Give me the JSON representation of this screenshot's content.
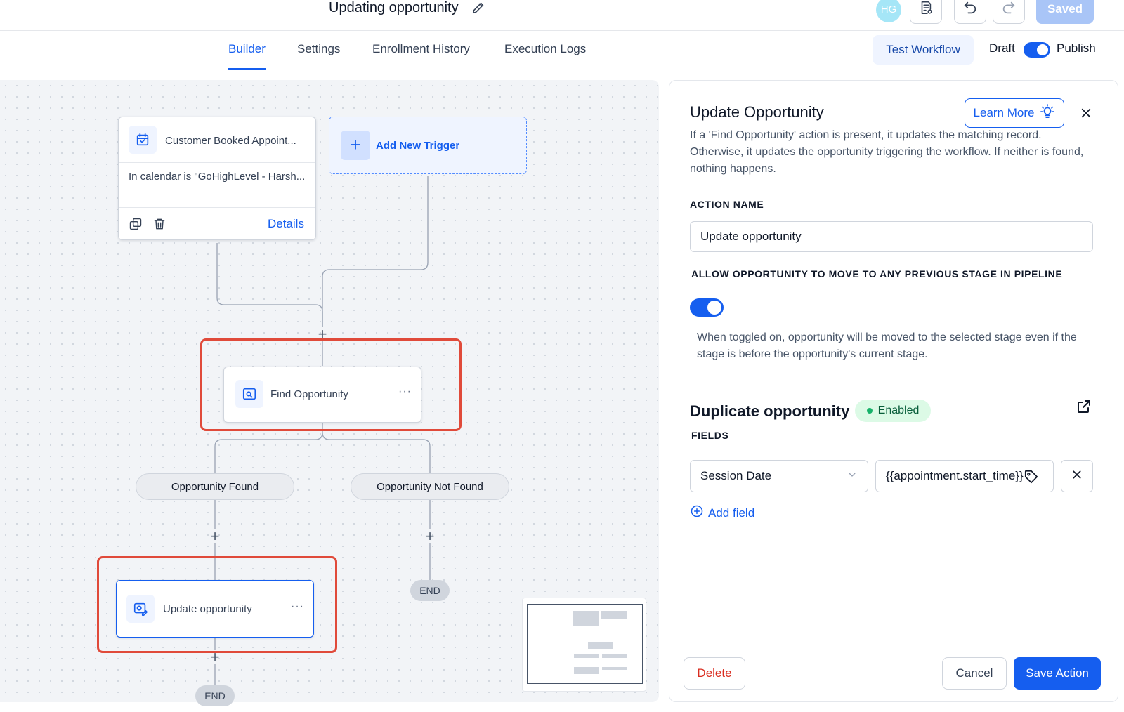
{
  "header": {
    "title": "Updating opportunity",
    "avatar_initials": "HG",
    "saved_label": "Saved"
  },
  "tabs": [
    {
      "label": "Builder",
      "active": true
    },
    {
      "label": "Settings",
      "active": false
    },
    {
      "label": "Enrollment History",
      "active": false
    },
    {
      "label": "Execution Logs",
      "active": false
    }
  ],
  "toolbar": {
    "test_label": "Test Workflow",
    "draft_label": "Draft",
    "publish_label": "Publish",
    "publish_on": true
  },
  "canvas": {
    "trigger": {
      "title": "Customer Booked Appoint...",
      "filter": "In calendar is \"GoHighLevel - Harsh...",
      "details_label": "Details"
    },
    "add_trigger_label": "Add New Trigger",
    "find_node": {
      "title": "Find Opportunity"
    },
    "branches": [
      "Opportunity Found",
      "Opportunity Not Found"
    ],
    "update_node": {
      "title": "Update opportunity"
    },
    "end_label": "END"
  },
  "panel": {
    "title": "Update Opportunity",
    "learn_more_label": "Learn More",
    "description": "If a 'Find Opportunity' action is present, it updates the matching record. Otherwise, it updates the opportunity triggering the workflow. If neither is found, nothing happens.",
    "action_name_label": "ACTION NAME",
    "action_name_value": "Update opportunity",
    "allow_move_label": "ALLOW OPPORTUNITY TO MOVE TO ANY PREVIOUS STAGE IN PIPELINE",
    "allow_move_on": true,
    "allow_move_help": "When toggled on, opportunity will be moved to the selected stage even if the stage is before the opportunity's current stage.",
    "duplicate_title": "Duplicate opportunity",
    "duplicate_status": "Enabled",
    "fields_label": "FIELDS",
    "field_name": "Session Date",
    "field_value": "{{appointment.start_time}}",
    "add_field_label": "Add field",
    "delete_label": "Delete",
    "cancel_label": "Cancel",
    "save_label": "Save Action"
  },
  "colors": {
    "accent": "#155eef",
    "highlight": "#e04a3a",
    "enabled_dot": "#17b26a",
    "delete_text": "#d92d20"
  },
  "icons": [
    "edit-icon",
    "notes-icon",
    "undo-icon",
    "redo-icon",
    "calendar-icon",
    "copy-icon",
    "trash-icon",
    "plus-icon",
    "search-opportunity-icon",
    "update-opportunity-icon",
    "more-icon",
    "lightbulb-icon",
    "close-icon",
    "external-link-icon",
    "chevron-down-icon",
    "tag-icon",
    "add-circle-icon"
  ]
}
